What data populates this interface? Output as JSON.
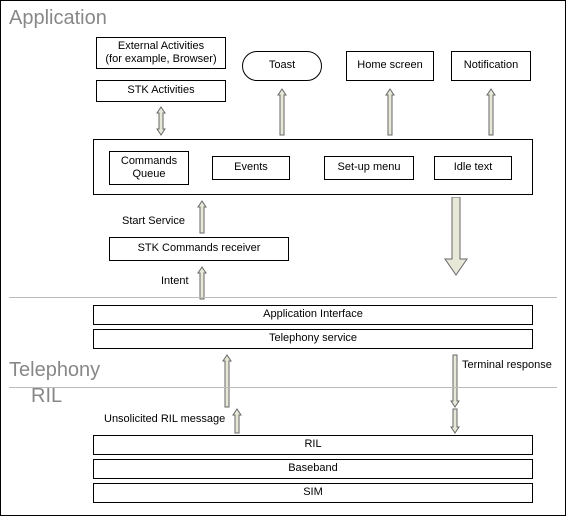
{
  "sections": {
    "application": "Application",
    "telephony": "Telephony",
    "ril": "RIL"
  },
  "boxes": {
    "external_activities": "External Activities\n(for example, Browser)",
    "stk_activities": "STK Activities",
    "toast": "Toast",
    "home_screen": "Home screen",
    "notification": "Notification",
    "commands_queue": "Commands\nQueue",
    "events": "Events",
    "setup_menu": "Set-up menu",
    "idle_text": "Idle text",
    "stk_commands_receiver": "STK Commands receiver",
    "application_interface": "Application Interface",
    "telephony_service": "Telephony service",
    "ril": "RIL",
    "baseband": "Baseband",
    "sim": "SIM"
  },
  "labels": {
    "start_service": "Start Service",
    "intent": "Intent",
    "unsolicited": "Unsolicited RIL message",
    "terminal_response": "Terminal response"
  }
}
